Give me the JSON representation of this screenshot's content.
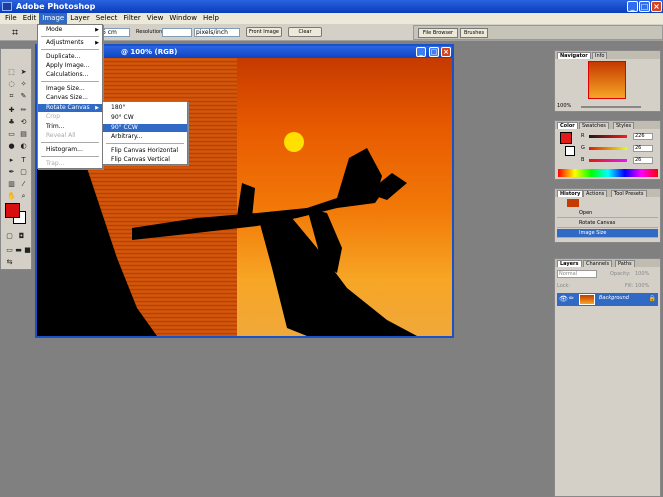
{
  "window": {
    "title": "Adobe Photoshop",
    "buttons": {
      "minimize": "_",
      "maximize": "□",
      "close": "×"
    }
  },
  "menubar": [
    "File",
    "Edit",
    "Image",
    "Layer",
    "Select",
    "Filter",
    "View",
    "Window",
    "Help"
  ],
  "options_bar": {
    "height_value": "6 cm",
    "resolution_label": "Resolution:",
    "resolution_unit": "pixels/inch",
    "front_image": "Front Image",
    "clear": "Clear",
    "file_browser": "File Browser",
    "brushes": "Brushes"
  },
  "document": {
    "title": "@ 100% (RGB)"
  },
  "image_menu": {
    "items": [
      {
        "label": "Mode",
        "submenu": true
      },
      {
        "label": "Adjustments",
        "submenu": true
      },
      {
        "label": "Duplicate..."
      },
      {
        "label": "Apply Image..."
      },
      {
        "label": "Calculations..."
      },
      {
        "label": "Image Size..."
      },
      {
        "label": "Canvas Size..."
      },
      {
        "label": "Rotate Canvas",
        "submenu": true
      },
      {
        "label": "Crop"
      },
      {
        "label": "Trim..."
      },
      {
        "label": "Reveal All"
      },
      {
        "label": "Histogram..."
      },
      {
        "label": "Trap..."
      }
    ]
  },
  "rotate_menu": {
    "items": [
      "180°",
      "90° CW",
      "90° CCW",
      "Arbitrary...",
      "Flip Canvas Horizontal",
      "Flip Canvas Vertical"
    ]
  },
  "navigator": {
    "tabs": [
      "Navigator",
      "Info"
    ],
    "zoom": "100%"
  },
  "color_panel": {
    "tabs": [
      "Color",
      "Swatches",
      "Styles"
    ],
    "channels": [
      {
        "label": "R",
        "value": "226"
      },
      {
        "label": "G",
        "value": "26"
      },
      {
        "label": "B",
        "value": "26"
      }
    ]
  },
  "history_panel": {
    "tabs": [
      "History",
      "Actions",
      "Tool Presets"
    ],
    "items": [
      "Open",
      "Rotate Canvas",
      "Image Size"
    ]
  },
  "layers_panel": {
    "tabs": [
      "Layers",
      "Channels",
      "Paths"
    ],
    "blend_mode": "Normal",
    "opacity_label": "Opacity:",
    "opacity_value": "100%",
    "lock_label": "Lock:",
    "fill_label": "Fill:",
    "fill_value": "100%",
    "layers": [
      "Background"
    ]
  },
  "colors": {
    "foreground": "#e21a1a",
    "accent": "#316ac5"
  }
}
